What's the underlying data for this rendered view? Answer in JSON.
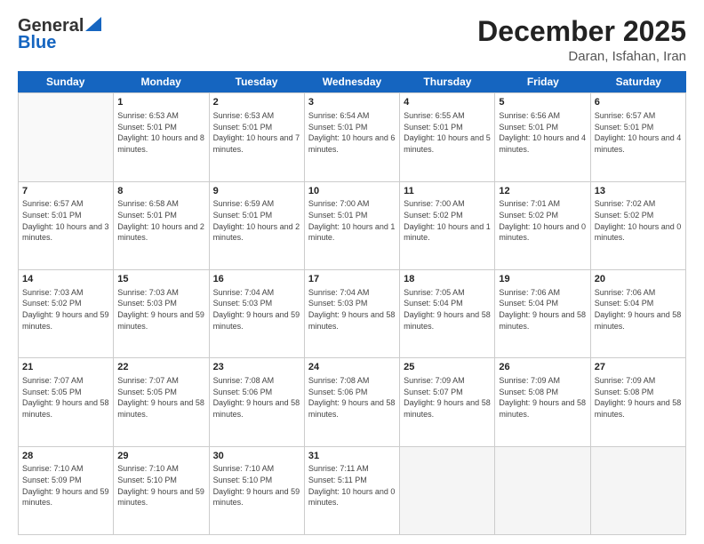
{
  "logo": {
    "general": "General",
    "blue": "Blue"
  },
  "header": {
    "title": "December 2025",
    "subtitle": "Daran, Isfahan, Iran"
  },
  "weekdays": [
    "Sunday",
    "Monday",
    "Tuesday",
    "Wednesday",
    "Thursday",
    "Friday",
    "Saturday"
  ],
  "weeks": [
    [
      {
        "day": "",
        "empty": true
      },
      {
        "day": "1",
        "sunrise": "6:53 AM",
        "sunset": "5:01 PM",
        "daylight": "10 hours and 8 minutes."
      },
      {
        "day": "2",
        "sunrise": "6:53 AM",
        "sunset": "5:01 PM",
        "daylight": "10 hours and 7 minutes."
      },
      {
        "day": "3",
        "sunrise": "6:54 AM",
        "sunset": "5:01 PM",
        "daylight": "10 hours and 6 minutes."
      },
      {
        "day": "4",
        "sunrise": "6:55 AM",
        "sunset": "5:01 PM",
        "daylight": "10 hours and 5 minutes."
      },
      {
        "day": "5",
        "sunrise": "6:56 AM",
        "sunset": "5:01 PM",
        "daylight": "10 hours and 4 minutes."
      },
      {
        "day": "6",
        "sunrise": "6:57 AM",
        "sunset": "5:01 PM",
        "daylight": "10 hours and 4 minutes."
      }
    ],
    [
      {
        "day": "7",
        "sunrise": "6:57 AM",
        "sunset": "5:01 PM",
        "daylight": "10 hours and 3 minutes."
      },
      {
        "day": "8",
        "sunrise": "6:58 AM",
        "sunset": "5:01 PM",
        "daylight": "10 hours and 2 minutes."
      },
      {
        "day": "9",
        "sunrise": "6:59 AM",
        "sunset": "5:01 PM",
        "daylight": "10 hours and 2 minutes."
      },
      {
        "day": "10",
        "sunrise": "7:00 AM",
        "sunset": "5:01 PM",
        "daylight": "10 hours and 1 minute."
      },
      {
        "day": "11",
        "sunrise": "7:00 AM",
        "sunset": "5:02 PM",
        "daylight": "10 hours and 1 minute."
      },
      {
        "day": "12",
        "sunrise": "7:01 AM",
        "sunset": "5:02 PM",
        "daylight": "10 hours and 0 minutes."
      },
      {
        "day": "13",
        "sunrise": "7:02 AM",
        "sunset": "5:02 PM",
        "daylight": "10 hours and 0 minutes."
      }
    ],
    [
      {
        "day": "14",
        "sunrise": "7:03 AM",
        "sunset": "5:02 PM",
        "daylight": "9 hours and 59 minutes."
      },
      {
        "day": "15",
        "sunrise": "7:03 AM",
        "sunset": "5:03 PM",
        "daylight": "9 hours and 59 minutes."
      },
      {
        "day": "16",
        "sunrise": "7:04 AM",
        "sunset": "5:03 PM",
        "daylight": "9 hours and 59 minutes."
      },
      {
        "day": "17",
        "sunrise": "7:04 AM",
        "sunset": "5:03 PM",
        "daylight": "9 hours and 58 minutes."
      },
      {
        "day": "18",
        "sunrise": "7:05 AM",
        "sunset": "5:04 PM",
        "daylight": "9 hours and 58 minutes."
      },
      {
        "day": "19",
        "sunrise": "7:06 AM",
        "sunset": "5:04 PM",
        "daylight": "9 hours and 58 minutes."
      },
      {
        "day": "20",
        "sunrise": "7:06 AM",
        "sunset": "5:04 PM",
        "daylight": "9 hours and 58 minutes."
      }
    ],
    [
      {
        "day": "21",
        "sunrise": "7:07 AM",
        "sunset": "5:05 PM",
        "daylight": "9 hours and 58 minutes."
      },
      {
        "day": "22",
        "sunrise": "7:07 AM",
        "sunset": "5:05 PM",
        "daylight": "9 hours and 58 minutes."
      },
      {
        "day": "23",
        "sunrise": "7:08 AM",
        "sunset": "5:06 PM",
        "daylight": "9 hours and 58 minutes."
      },
      {
        "day": "24",
        "sunrise": "7:08 AM",
        "sunset": "5:06 PM",
        "daylight": "9 hours and 58 minutes."
      },
      {
        "day": "25",
        "sunrise": "7:09 AM",
        "sunset": "5:07 PM",
        "daylight": "9 hours and 58 minutes."
      },
      {
        "day": "26",
        "sunrise": "7:09 AM",
        "sunset": "5:08 PM",
        "daylight": "9 hours and 58 minutes."
      },
      {
        "day": "27",
        "sunrise": "7:09 AM",
        "sunset": "5:08 PM",
        "daylight": "9 hours and 58 minutes."
      }
    ],
    [
      {
        "day": "28",
        "sunrise": "7:10 AM",
        "sunset": "5:09 PM",
        "daylight": "9 hours and 59 minutes."
      },
      {
        "day": "29",
        "sunrise": "7:10 AM",
        "sunset": "5:10 PM",
        "daylight": "9 hours and 59 minutes."
      },
      {
        "day": "30",
        "sunrise": "7:10 AM",
        "sunset": "5:10 PM",
        "daylight": "9 hours and 59 minutes."
      },
      {
        "day": "31",
        "sunrise": "7:11 AM",
        "sunset": "5:11 PM",
        "daylight": "10 hours and 0 minutes."
      },
      {
        "day": "",
        "empty": true
      },
      {
        "day": "",
        "empty": true
      },
      {
        "day": "",
        "empty": true
      }
    ]
  ]
}
